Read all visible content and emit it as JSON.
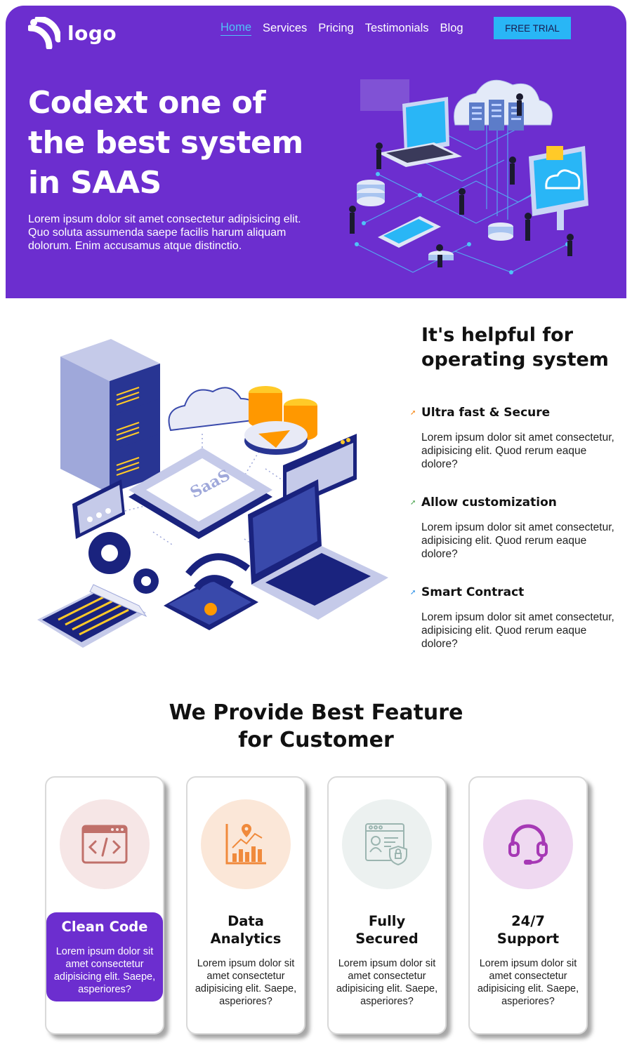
{
  "brand": {
    "logo_text": "logo"
  },
  "nav": {
    "items": [
      {
        "label": "Home",
        "active": true
      },
      {
        "label": "Services",
        "active": false
      },
      {
        "label": "Pricing",
        "active": false
      },
      {
        "label": "Testimonials",
        "active": false
      },
      {
        "label": "Blog",
        "active": false
      }
    ],
    "cta": "FREE TRIAL"
  },
  "hero": {
    "title": "Codext one of the best system in SAAS",
    "description": "Lorem ipsum dolor sit amet consectetur adipisicing elit. Quo soluta assumenda saepe facilis harum aliquam dolorum. Enim accusamus atque distinctio."
  },
  "helpful": {
    "title": "It's helpful for operating system",
    "illustration_label": "SaaS",
    "features": [
      {
        "title": "Ultra fast & Secure",
        "desc": "Lorem ipsum dolor sit amet consectetur, adipisicing elit. Quod rerum eaque dolore?",
        "arrow_color": "#f57c00"
      },
      {
        "title": "Allow customization",
        "desc": "Lorem ipsum dolor sit amet consectetur, adipisicing elit. Quod rerum eaque dolore?",
        "arrow_color": "#43a047"
      },
      {
        "title": "Smart Contract",
        "desc": "Lorem ipsum dolor sit amet consectetur, adipisicing elit. Quod rerum eaque dolore?",
        "arrow_color": "#1e88e5"
      }
    ]
  },
  "features_section": {
    "title_line1": "We Provide Best Feature",
    "title_line2": "for Customer",
    "cards": [
      {
        "title": "Clean Code",
        "desc": "Lorem ipsum dolor sit amet consectetur adipisicing elit. Saepe, asperiores?",
        "icon": "code-window-icon",
        "circle_color": "#f6e6e6",
        "active": true
      },
      {
        "title": "Data Analytics",
        "desc": "Lorem ipsum dolor sit amet consectetur adipisicing elit. Saepe, asperiores?",
        "icon": "analytics-chart-icon",
        "circle_color": "#fbe7d8",
        "active": false
      },
      {
        "title": "Fully Secured",
        "desc": "Lorem ipsum dolor sit amet consectetur adipisicing elit. Saepe, asperiores?",
        "icon": "secure-profile-icon",
        "circle_color": "#ecf1f0",
        "active": false
      },
      {
        "title": "24/7 Support",
        "desc": "Lorem ipsum dolor sit amet consectetur adipisicing elit. Saepe, asperiores?",
        "icon": "headset-icon",
        "circle_color": "#efd9f1",
        "active": false
      }
    ]
  },
  "colors": {
    "primary": "#6c2ecf",
    "accent": "#29b6f6",
    "nav_active": "#4fc3f7"
  }
}
